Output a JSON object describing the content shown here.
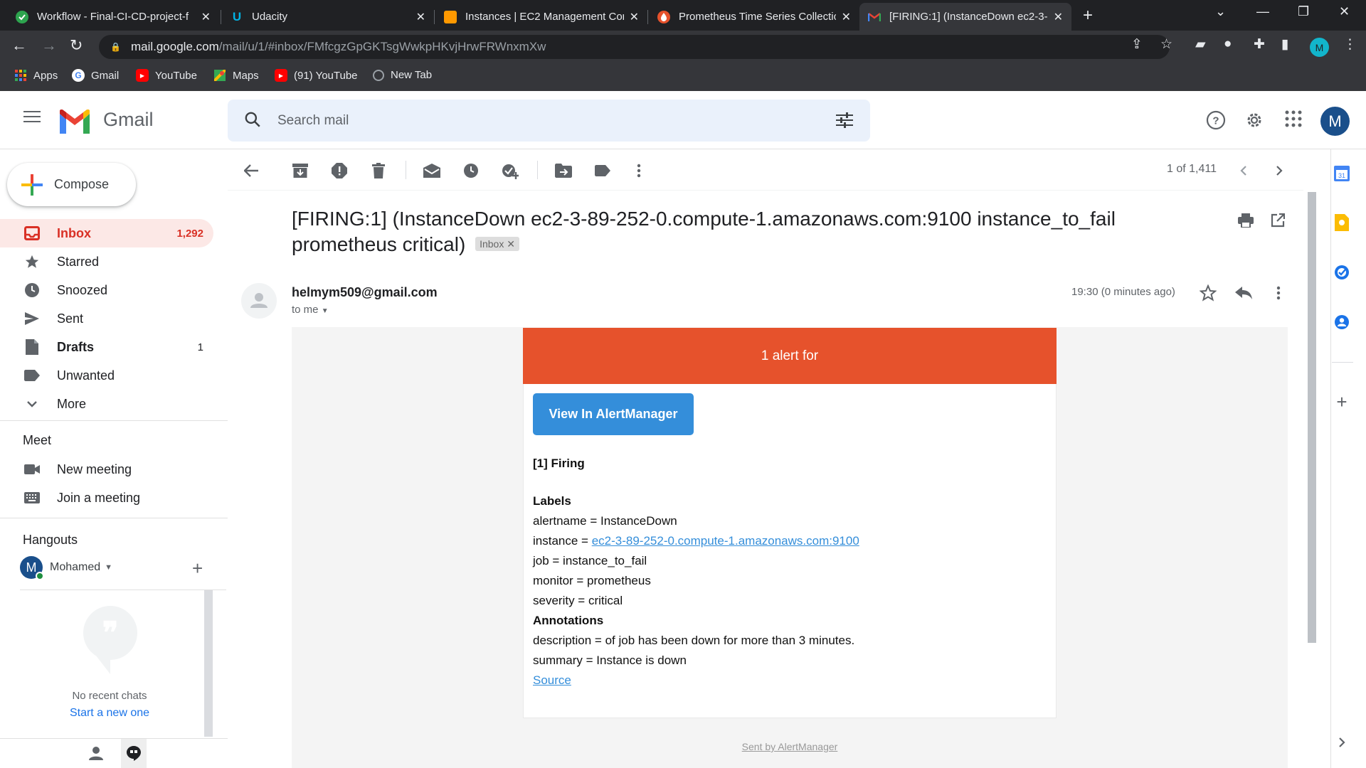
{
  "browser": {
    "tabs": [
      {
        "title": "Workflow - Final-CI-CD-project-f",
        "icon": "github-actions-icon",
        "color": "#2da44e"
      },
      {
        "title": "Udacity",
        "icon": "udacity-icon",
        "color": "#02b3e4"
      },
      {
        "title": "Instances | EC2 Management Con",
        "icon": "aws-ec2-icon",
        "color": "#f90"
      },
      {
        "title": "Prometheus Time Series Collectio",
        "icon": "prometheus-icon",
        "color": "#e6522c"
      },
      {
        "title": "[FIRING:1] (InstanceDown ec2-3-",
        "icon": "gmail-icon",
        "color": "#ea4335",
        "active": true
      }
    ],
    "url_host": "mail.google.com",
    "url_path": "/mail/u/1/#inbox/FMfcgzGpGKTsgWwkpHKvjHrwFRWnxmXw",
    "profile_letter": "M",
    "bookmarks": [
      {
        "label": "Apps",
        "icon": "apps-grid-icon"
      },
      {
        "label": "Gmail",
        "icon": "google-icon"
      },
      {
        "label": "YouTube",
        "icon": "youtube-icon"
      },
      {
        "label": "Maps",
        "icon": "maps-icon"
      },
      {
        "label": "(91) YouTube",
        "icon": "youtube-icon"
      },
      {
        "label": "New Tab",
        "icon": "globe-icon"
      }
    ]
  },
  "gmail": {
    "brand": "Gmail",
    "search_placeholder": "Search mail",
    "avatar_letter": "M",
    "compose_label": "Compose",
    "nav": [
      {
        "label": "Inbox",
        "count": "1,292",
        "icon": "inbox-icon",
        "active": true
      },
      {
        "label": "Starred",
        "count": "",
        "icon": "star-icon"
      },
      {
        "label": "Snoozed",
        "count": "",
        "icon": "clock-icon"
      },
      {
        "label": "Sent",
        "count": "",
        "icon": "send-icon"
      },
      {
        "label": "Drafts",
        "count": "1",
        "icon": "draft-icon",
        "bold": true
      },
      {
        "label": "Unwanted",
        "count": "",
        "icon": "label-icon"
      },
      {
        "label": "More",
        "count": "",
        "icon": "chevron-down-icon"
      }
    ],
    "meet": {
      "title": "Meet",
      "items": [
        {
          "label": "New meeting",
          "icon": "video-icon"
        },
        {
          "label": "Join a meeting",
          "icon": "keyboard-icon"
        }
      ]
    },
    "hangouts": {
      "title": "Hangouts",
      "user": "Mohamed",
      "user_letter": "M",
      "empty_text": "No recent chats",
      "start_link": "Start a new one"
    },
    "pager": "1 of 1,411"
  },
  "email": {
    "subject": "[FIRING:1] (InstanceDown ec2-3-89-252-0.compute-1.amazonaws.com:9100 instance_to_fail prometheus critical)",
    "label_chip": "Inbox",
    "sender": "helmym509@gmail.com",
    "to": "to me",
    "time": "19:30 (0 minutes ago)",
    "banner": "1 alert for",
    "button": "View In AlertManager",
    "firing_heading": "[1] Firing",
    "labels_heading": "Labels",
    "alertname": "alertname = InstanceDown",
    "instance_prefix": "instance = ",
    "instance_link": "ec2-3-89-252-0.compute-1.amazonaws.com:9100",
    "job": "job = instance_to_fail",
    "monitor": "monitor = prometheus",
    "severity": "severity = critical",
    "annotations_heading": "Annotations",
    "description": "description = of job has been down for more than 3 minutes.",
    "summary": "summary = Instance is down",
    "source_link": "Source",
    "footer": "Sent by AlertManager",
    "colors": {
      "banner": "#e6522c",
      "button": "#348eda"
    }
  }
}
